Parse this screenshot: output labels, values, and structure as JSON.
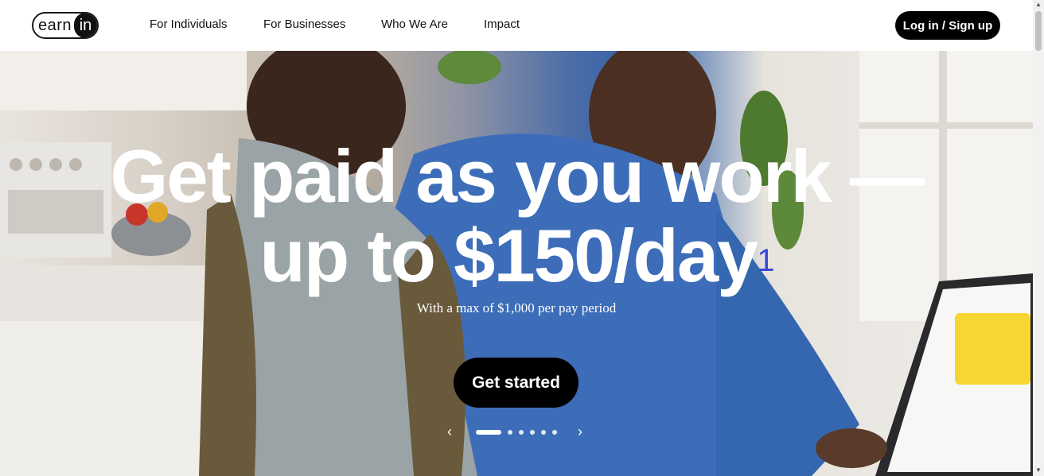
{
  "brand": {
    "logo_left": "earn",
    "logo_right": "in"
  },
  "nav": {
    "links": [
      "For Individuals",
      "For Businesses",
      "Who We Are",
      "Impact"
    ],
    "login_label": "Log in / Sign up"
  },
  "hero": {
    "title_line1": "Get paid as you work —",
    "title_line2": "up to $150/day",
    "footnote": "1",
    "subtitle": "With a max of $1,000 per pay period",
    "cta_label": "Get started",
    "carousel": {
      "prev": "‹",
      "next": "›",
      "slide_count": 6,
      "active_index": 0
    }
  },
  "colors": {
    "accent": "#000000",
    "footnote": "#3a48d8",
    "text": "#111111"
  }
}
